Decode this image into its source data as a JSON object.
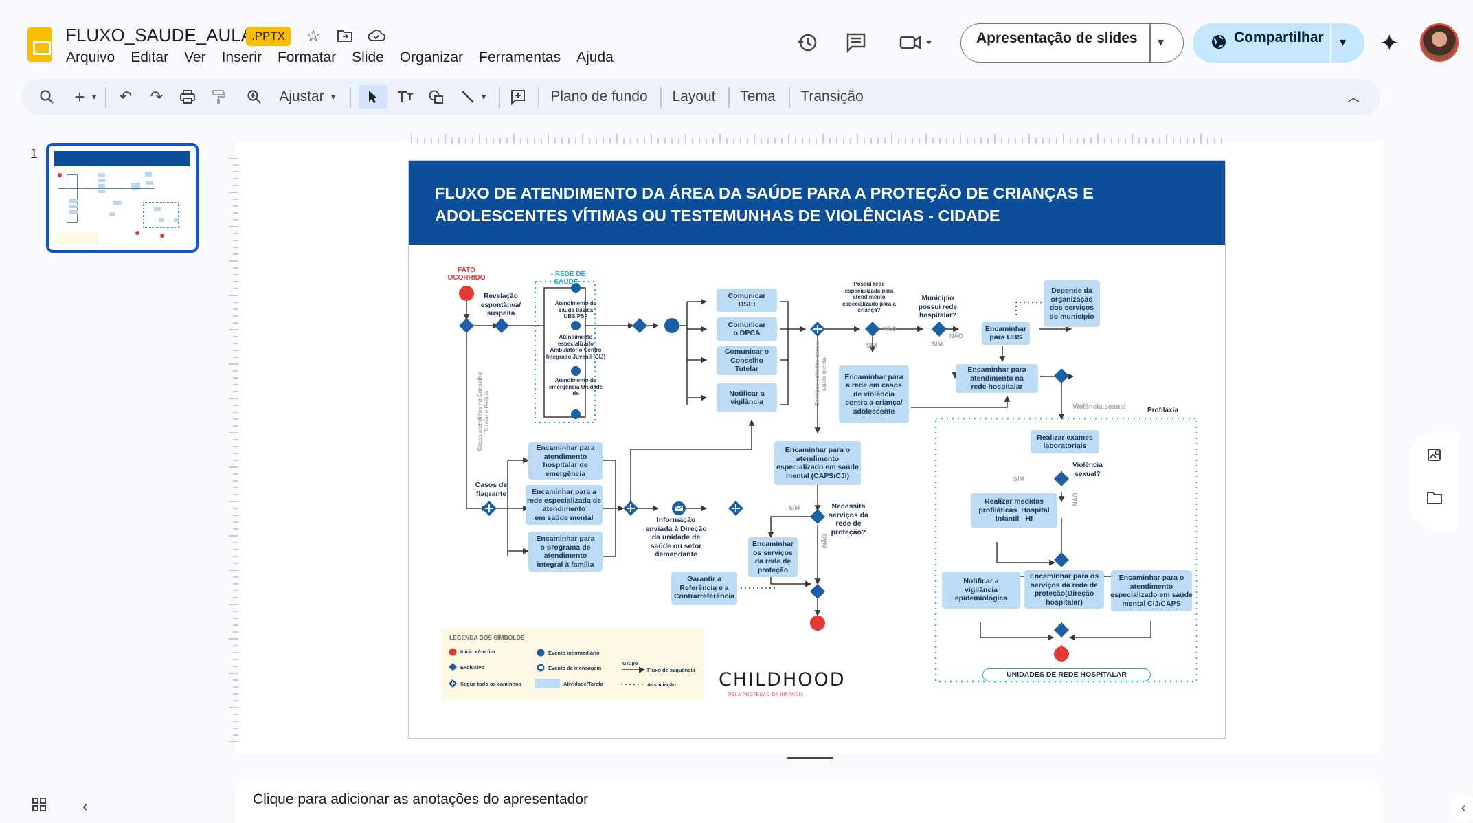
{
  "header": {
    "doc_title": "FLUXO_SAUDE_AULA",
    "ext_badge": ".PPTX",
    "menu": [
      "Arquivo",
      "Editar",
      "Ver",
      "Inserir",
      "Formatar",
      "Slide",
      "Organizar",
      "Ferramentas",
      "Ajuda"
    ],
    "present_label": "Apresentação de slides",
    "share_label": "Compartilhar"
  },
  "toolbar": {
    "zoom_label": "Ajustar",
    "background_label": "Plano de fundo",
    "layout_label": "Layout",
    "theme_label": "Tema",
    "transition_label": "Transição"
  },
  "filmstrip": {
    "slide_number": "1"
  },
  "slide": {
    "title_line1": "FLUXO DE ATENDIMENTO DA ÁREA DA SAÚDE PARA A PROTEÇÃO DE CRIANÇAS E",
    "title_line2": "ADOLESCENTES VÍTIMAS OU TESTEMUNHAS DE VIOLÊNCIAS - CIDADE",
    "labels": {
      "fato": "FATO\nOCORRIDO",
      "rede_saude": "- REDE DE SAÚDE -",
      "revelacao": "Revelação\nespontânea/\nsuspeita",
      "casos_flagrante": "Casos de\nflagrante",
      "casos_conselho": "Casos atendidos no Conselho\nTutelar e Polícia",
      "servicos_mental": "Serviços voltados para a\nsaúde mental",
      "ab_saude": "Atendimento de\nsaúde básica\nUBS/PSF",
      "ab_especializado": "Atendimento\nespecializado\nAmbulatório Centro\nIntegrado Juvenil (CIJ)",
      "ab_emergencia": "Atendimento de\nemergência Unidade\nde",
      "possui_rede": "Possui rede\nespecializada para\natendimento\nespecializado para a\ncriança?",
      "municipio": "Município\npossui rede\nhospitalar?",
      "informacao": "Informação\nenviada à Direção\nda unidade de\nsaúde ou setor\ndemandante",
      "necessita": "Necessita\nserviços da\nrede de\nproteção?",
      "violencia_sexual_q": "Violência\nsexual?",
      "violencia_sexual": "Violência sexual",
      "profilaxia": "Profilaxia",
      "sim": "SIM",
      "nao": "NÃO",
      "unidades": "UNIDADES DE REDE HOSPITALAR"
    },
    "boxes": {
      "dsei": "Comunicar\nDSEI",
      "dpca": "Comunicar\no DPCA",
      "conselho": "Comunicar o\nConselho\nTutelar",
      "vigilancia": "Notificar a\nvigilância",
      "rede_casos": "Encaminhar para\na rede em casos\nde violência\ncontra a criança/\nadolescente",
      "ubs": "Encaminhar\npara UBS",
      "depende": "Depende da\norganização\ndos serviços\ndo município",
      "hospitalar": "Encaminhar para\natendimento na\nrede hospitalar",
      "hosp_emergencia": "Encaminhar para\natendimento\nhospitalar de\nemergência",
      "rede_mental": "Encaminhar para a\nrede especializada de\natendimento\nem saúde mental",
      "programa": "Encaminhar para\no programa de\natendimento\nintegral à família",
      "caps": "Encaminhar para o\natendimento\nespecializado em saúde\nmental (CAPS/CJI)",
      "servicos_rede": "Encaminhar\nos serviços\nda rede de\nproteção",
      "referencia": "Garantir a\nReferência e a\nContrarreferência",
      "exames": "Realizar exames\nlaboratoriais",
      "medidas": "Realizar medidas\nprofiláticas  Hospital\nInfantil - HI",
      "epidemiologica": "Notificar a\nvigilância\nepidemiológica",
      "direcao": "Encaminhar para os\nserviços da rede de\nproteção(Direção\nhospitalar)",
      "cij_caps": "Encaminhar para o\natendimento\nespecializado em saúde\nmental CIJ/CAPS"
    },
    "legend": {
      "title": "LEGENDA DOS SÍMBOLOS",
      "inicio": "Início e/ou fim",
      "exclusivo": "Exclusivo",
      "segue": "Segue todo os caminhos",
      "intermediario": "Evento intermediário",
      "mensagem": "Evento de mensagem",
      "atividade": "Atividade/Tarefa",
      "grupo": "Grupo",
      "fluxo": "Fluxo de sequência",
      "associacao": "Associação"
    },
    "brand": "CHILDHOOD",
    "brand_sub": "PELA PROTEÇÃO DA INFÂNCIA"
  },
  "notes": {
    "placeholder": "Clique para adicionar as anotações do apresentador"
  },
  "colors": {
    "accent": "#0b57d0",
    "slide_header": "#0d4e9a",
    "box": "#bcdcf6",
    "node": "#1b5fa6",
    "red": "#e53935",
    "share": "#c2e7ff"
  }
}
